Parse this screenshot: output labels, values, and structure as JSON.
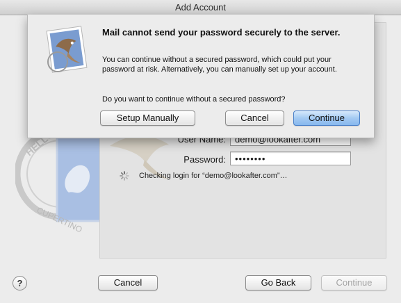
{
  "window": {
    "title": "Add Account"
  },
  "sheet": {
    "icon": "mail-stamp-icon",
    "title": "Mail cannot send your password securely to the server.",
    "body": "You can continue without a secured password, which could put your password at risk. Alternatively, you can manually set up your account.",
    "question": "Do you want to continue without a secured password?",
    "buttons": {
      "setup_manually": "Setup Manually",
      "cancel": "Cancel",
      "continue": "Continue"
    }
  },
  "form": {
    "user_name_label": "User Name:",
    "user_name_value": "demo@lookafter.com",
    "password_label": "Password:",
    "password_value": "••••••••",
    "status": "Checking login for “demo@lookafter.com”…"
  },
  "footer": {
    "help": "?",
    "cancel": "Cancel",
    "go_back": "Go Back",
    "continue": "Continue"
  },
  "colors": {
    "default_button": "#86b7ee",
    "window_bg": "#ececec",
    "stamp_blue": "#7a9cd0"
  }
}
